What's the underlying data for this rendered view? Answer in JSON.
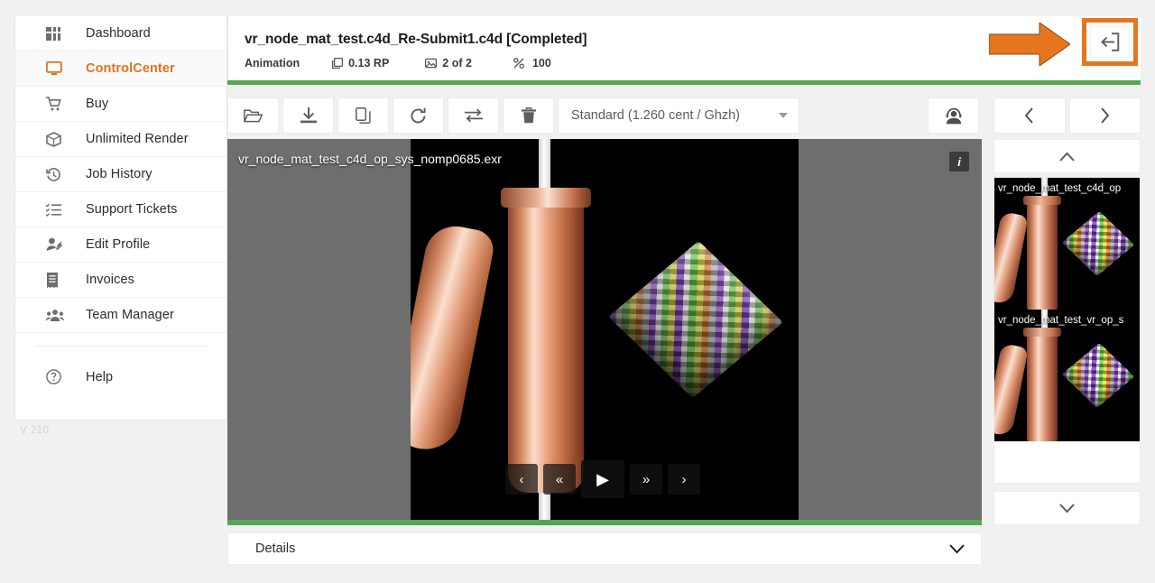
{
  "app": {
    "version_label": "V 210",
    "accent_orange": "#e5761f",
    "status_green": "#55a652"
  },
  "sidebar": {
    "items": [
      {
        "label": "Dashboard",
        "icon": "dashboard-icon",
        "active": false
      },
      {
        "label": "ControlCenter",
        "icon": "monitor-icon",
        "active": true
      },
      {
        "label": "Buy",
        "icon": "cart-icon",
        "active": false
      },
      {
        "label": "Unlimited Render",
        "icon": "box-icon",
        "active": false
      },
      {
        "label": "Job History",
        "icon": "history-icon",
        "active": false
      },
      {
        "label": "Support Tickets",
        "icon": "checklist-icon",
        "active": false
      },
      {
        "label": "Edit Profile",
        "icon": "user-edit-icon",
        "active": false
      },
      {
        "label": "Invoices",
        "icon": "invoice-icon",
        "active": false
      },
      {
        "label": "Team Manager",
        "icon": "team-icon",
        "active": false
      }
    ],
    "help": {
      "label": "Help",
      "icon": "question-circle-icon"
    }
  },
  "header": {
    "job_title": "vr_node_mat_test.c4d_Re-Submit1.c4d [Completed]",
    "meta": [
      {
        "icon": "layers-icon",
        "text": "Animation"
      },
      {
        "icon": "stack-icon",
        "text": "0.13 RP"
      },
      {
        "icon": "frames-icon",
        "text": "2 of 2"
      },
      {
        "icon": "percent-icon",
        "text": "100"
      }
    ],
    "back_button": {
      "icon": "exit-left-icon",
      "highlighted": true
    },
    "annotation": {
      "shape": "right-arrow",
      "color": "#e5761f"
    }
  },
  "toolbar": {
    "buttons": [
      {
        "name": "open-folder-button",
        "icon": "folder-open-icon"
      },
      {
        "name": "download-button",
        "icon": "download-icon"
      },
      {
        "name": "copy-button",
        "icon": "copy-icon"
      },
      {
        "name": "rerender-button",
        "icon": "refresh-icon"
      },
      {
        "name": "transfer-button",
        "icon": "swap-arrows-icon"
      },
      {
        "name": "delete-button",
        "icon": "trash-icon"
      }
    ],
    "priority_select": {
      "value": "Standard (1.260 cent / Ghzh)",
      "icon": "chevron-down-icon"
    },
    "support_button": {
      "icon": "headset-support-icon"
    },
    "pager": {
      "prev": {
        "icon": "chevron-left-icon"
      },
      "next": {
        "icon": "chevron-right-icon"
      }
    }
  },
  "viewer": {
    "file_label": "vr_node_mat_test_c4d_op_sys_nomp0685.exr",
    "info_badge": "i",
    "playback": [
      {
        "name": "step-back-button",
        "glyph": "‹"
      },
      {
        "name": "rewind-button",
        "glyph": "«"
      },
      {
        "name": "play-button",
        "glyph": "▶"
      },
      {
        "name": "fast-forward-button",
        "glyph": "»"
      },
      {
        "name": "step-forward-button",
        "glyph": "›"
      }
    ]
  },
  "details": {
    "label": "Details",
    "icon": "chevron-down-icon"
  },
  "thumbnails": {
    "scroll_up_icon": "chevron-up-icon",
    "scroll_down_icon": "chevron-down-icon",
    "items": [
      {
        "label": "vr_node_mat_test_c4d_op"
      },
      {
        "label": "vr_node_mat_test_vr_op_s"
      }
    ]
  }
}
